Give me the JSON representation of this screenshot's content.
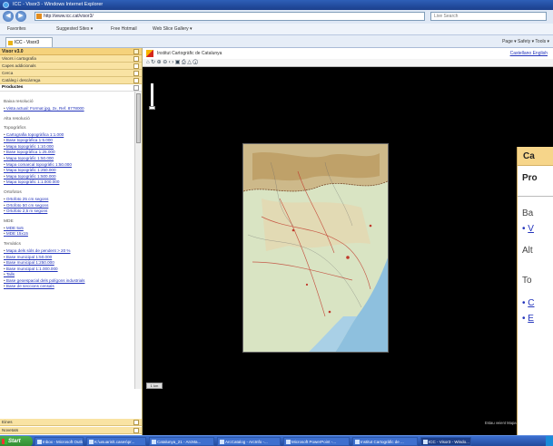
{
  "browser": {
    "title": "ICC - Visor3 - Windows Internet Explorer",
    "address": "http://www.icc.cat/visor3/",
    "search_placeholder": "Live Search",
    "favorites": "Favorites",
    "fav_items": [
      "Suggested Sites ▾",
      "Free Hotmail",
      "Web Slice Gallery ▾"
    ],
    "tab_label": "ICC - Visor3",
    "command_bar": "Page ▾  Safety ▾  Tools ▾"
  },
  "sidebar": {
    "app_title": "Visor v3.0",
    "panels": [
      "Visors i cartografia",
      "Capes addicionals",
      "Cerca",
      "Catàleg i descàrrega"
    ],
    "section": "Productes",
    "groups": [
      {
        "title": "Baixa resolució",
        "items": [
          "Vista actual: Format jpg, 2x, Ref. 8778000"
        ]
      },
      {
        "title": "Alta resolució",
        "items": []
      },
      {
        "title": "Topogràfics",
        "items": [
          "Cartografia topogràfica 1:1.000",
          "Base topogràfica 1:5.000",
          "Mapa topogràfic 1:10.000",
          "Base topogràfica 1:25.000",
          "Mapa topogràfic 1:50.000",
          "Mapa comarcal topogràfic 1:50.000",
          "Mapa topogràfic 1:250.000",
          "Mapa topogràfic 1:500.000",
          "Mapa topogràfic 1:1.000.000"
        ]
      },
      {
        "title": "Ortofotos",
        "items": [
          "Ortofoto 25 cm segons",
          "Ortofoto 50 cm segons",
          "Ortofoto 2,5 m segons"
        ]
      },
      {
        "title": "MDE",
        "items": [
          "MDE 5x5",
          "MDE 15x15"
        ]
      },
      {
        "title": "Temàtics",
        "items": [
          "Mapa dels sòls de pendent > 20 %",
          "Base municipal 1:50.000",
          "Base municipal 1:250.000",
          "Base municipal 1:1.000.000",
          "Talls",
          "Base geoespacial dels polígons industrials",
          "Base de seccions censals"
        ]
      }
    ],
    "bottom_panels": [
      "Eines",
      "Novetats"
    ]
  },
  "map": {
    "header": "Institut Cartogràfic de Catalunya",
    "lang": "Castellano  English",
    "scale_label": "1 km",
    "status": "Estau veient Mapa topogràfic 1:1.00"
  },
  "popup": {
    "heading": "Ca",
    "title": "Pro",
    "group1": "Ba",
    "link1": "V",
    "group2": "Alt",
    "group3": "To",
    "link2": "C",
    "link3": "E"
  },
  "taskbar": {
    "start": "Start",
    "tasks": [
      "Inbox - Microsoft Outlook",
      "K:\\usuaris\\t.cases\\pr...",
      "Catalunya_21 - ArcMa...",
      "ArcCatalog - ArcInfo -...",
      "Microsoft PowerPoint -...",
      "Institut Cartogràfic de ...",
      "ICC - Visor3 - Windo..."
    ]
  }
}
